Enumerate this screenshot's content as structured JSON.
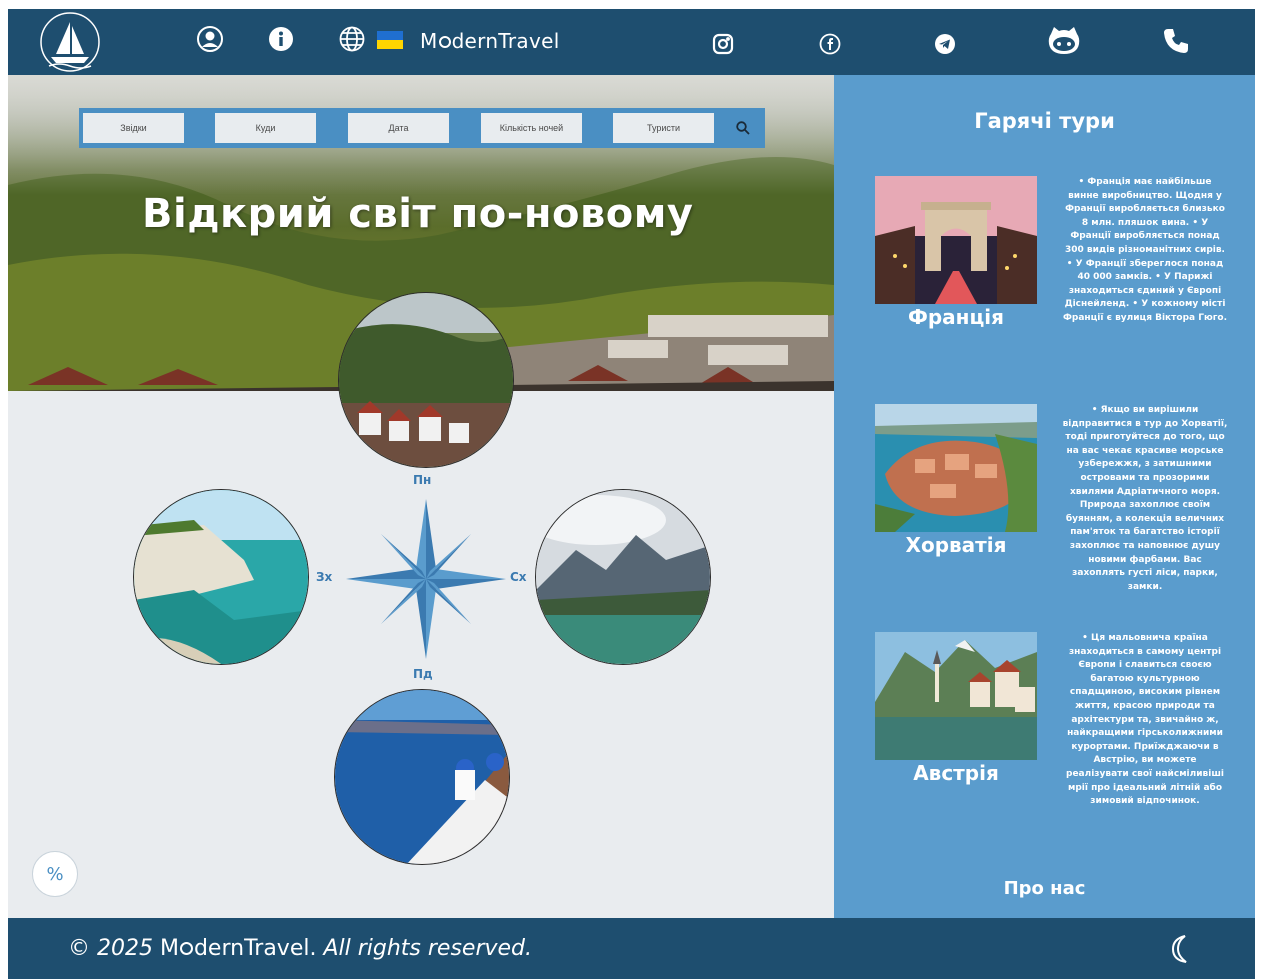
{
  "header": {
    "brand": "M●dernTravel",
    "brand_display_prefix": "M",
    "brand_display_suffix": "dernTravel",
    "icons": [
      "sailboat-logo-icon",
      "user-icon",
      "info-icon",
      "globe-icon",
      "ukraine-flag-icon",
      "instagram-icon",
      "facebook-icon",
      "telegram-icon",
      "github-icon",
      "phone-icon"
    ]
  },
  "search": {
    "fields": [
      "Звідки",
      "Куди",
      "Дата",
      "Кількість ночей",
      "Туристи"
    ]
  },
  "hero": {
    "headline": "Відкрий світ по-новому"
  },
  "compass": {
    "north": "Пн",
    "south": "Пд",
    "east": "Сх",
    "west": "Зх"
  },
  "panel": {
    "title": "Гарячі тури",
    "tours": [
      {
        "name": "Франція",
        "text": "• Франція має найбільше винне виробництво. Щодня у Франції виробляється близько 8 млн. пляшок вина. • У Франції виробляється понад 300 видів різноманітних сирів. • У Франції збереглося понад 40 000 замків. • У Парижі знаходиться єдиний у Європі Діснейленд. • У кожному місті Франції є вулиця Віктора Гюго."
      },
      {
        "name": "Хорватія",
        "text": "• Якщо ви вирішили відправитися в тур до Хорватії, тоді приготуйтеся до того, що на вас чекає красиве морське узбережжя, з затишними островами та прозорими хвилями Адріатичного моря. Природа захоплює своїм буянням, а колекція величних пам'яток та багатство історії захоплює та наповнює душу новими фарбами. Вас захоплять густі ліси, парки, замки."
      },
      {
        "name": "Австрія",
        "text": "• Ця мальовнича країна знаходиться в самому центрі Європи і славиться своєю багатою культурною спадщиною, високим рівнем життя, красою природи та архітектури та, звичайно ж, найкращими гірськолижними курортами. Приїжджаючи в Австрію, ви можете реалізувати свої найсміливіші мрії про ідеальний літній або зимовий відпочинок."
      }
    ],
    "about": "Про нас"
  },
  "discount_button": "%",
  "footer": {
    "copyright_prefix": "© 2025 ",
    "brand": "M●dernTravel.",
    "rights": "All rights reserved."
  },
  "colors": {
    "header_bg": "#1e4e6f",
    "panel_bg": "#5a9ccd",
    "search_bg": "#4a8fc3",
    "main_bg": "#e9ecef",
    "compass_blue": "#2f6f9f"
  }
}
